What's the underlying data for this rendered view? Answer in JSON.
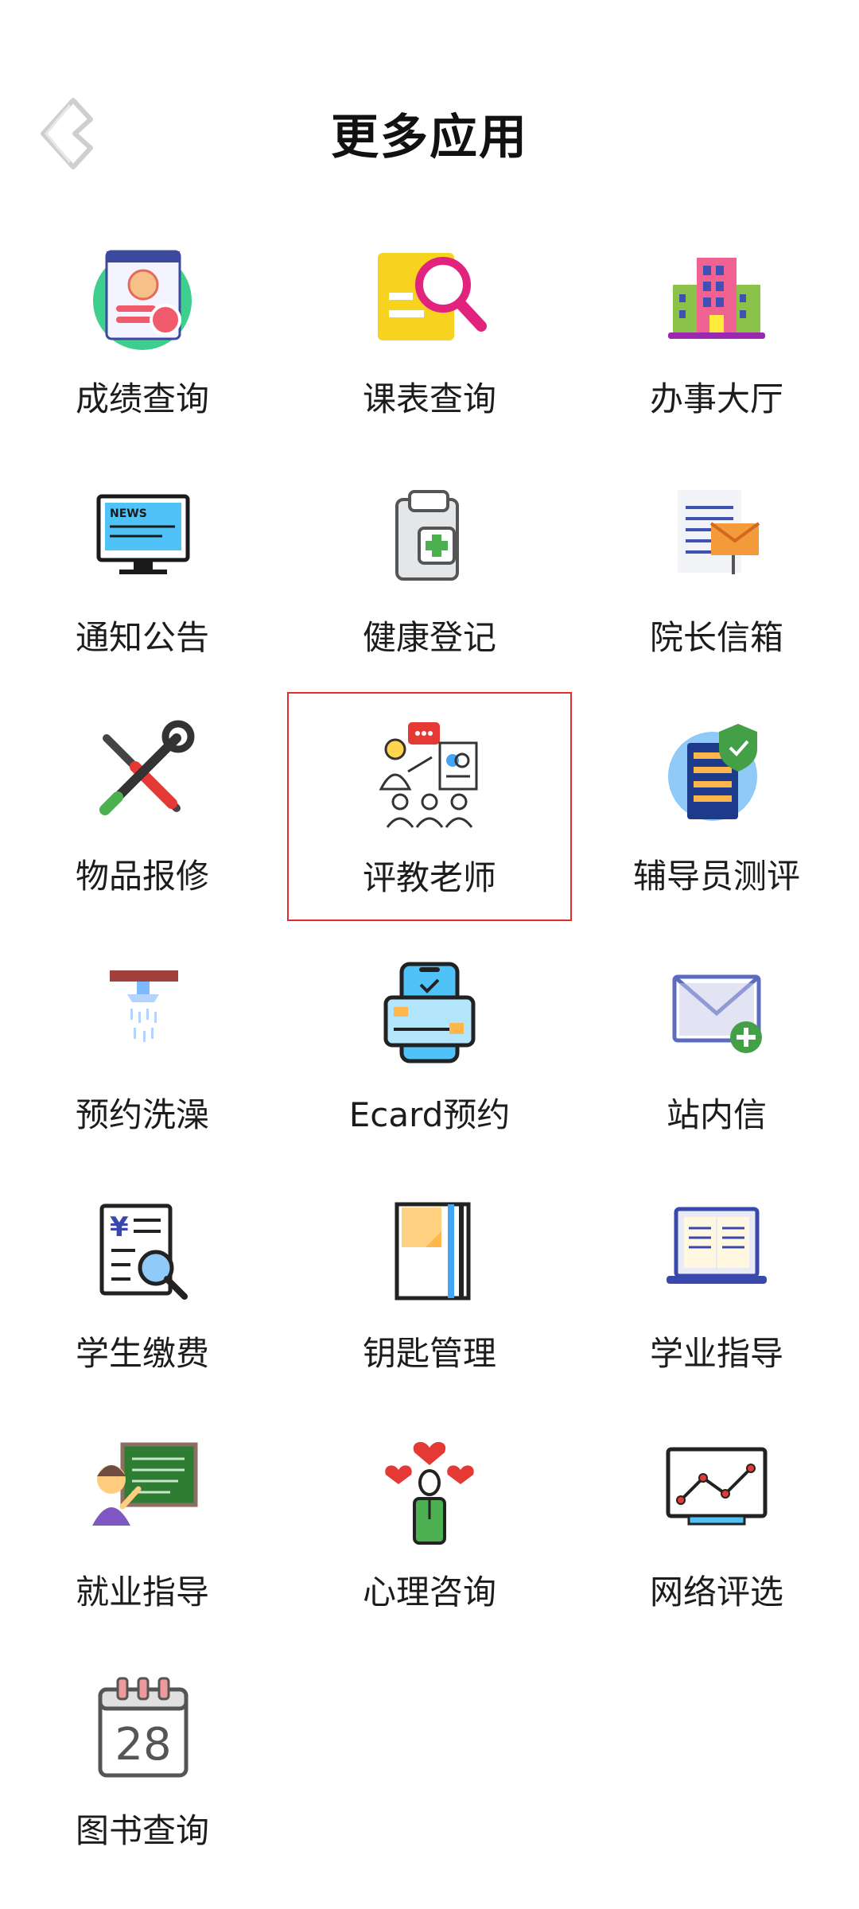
{
  "header": {
    "title": "更多应用"
  },
  "apps": [
    {
      "label": "成绩查询",
      "icon": "grade-report-icon"
    },
    {
      "label": "课表查询",
      "icon": "schedule-search-icon"
    },
    {
      "label": "办事大厅",
      "icon": "service-hall-building-icon"
    },
    {
      "label": "通知公告",
      "icon": "news-monitor-icon"
    },
    {
      "label": "健康登记",
      "icon": "health-clipboard-icon"
    },
    {
      "label": "院长信箱",
      "icon": "dean-mailbox-icon"
    },
    {
      "label": "物品报修",
      "icon": "repair-tools-icon"
    },
    {
      "label": "评教老师",
      "icon": "teacher-evaluation-icon"
    },
    {
      "label": "辅导员测评",
      "icon": "counselor-assessment-server-icon"
    },
    {
      "label": "预约洗澡",
      "icon": "shower-icon"
    },
    {
      "label": "Ecard预约",
      "icon": "ecard-phone-icon"
    },
    {
      "label": "站内信",
      "icon": "envelope-add-icon"
    },
    {
      "label": "学生缴费",
      "icon": "payment-search-icon"
    },
    {
      "label": "钥匙管理",
      "icon": "notebook-icon"
    },
    {
      "label": "学业指导",
      "icon": "open-book-laptop-icon"
    },
    {
      "label": "就业指导",
      "icon": "career-teacher-icon"
    },
    {
      "label": "心理咨询",
      "icon": "counseling-hearts-icon"
    },
    {
      "label": "网络评选",
      "icon": "line-chart-monitor-icon"
    },
    {
      "label": "图书查询",
      "icon": "calendar-icon"
    }
  ],
  "calendar_day": "28",
  "news_text": "NEWS",
  "colors": {
    "selection_border": "#e52a2a"
  }
}
